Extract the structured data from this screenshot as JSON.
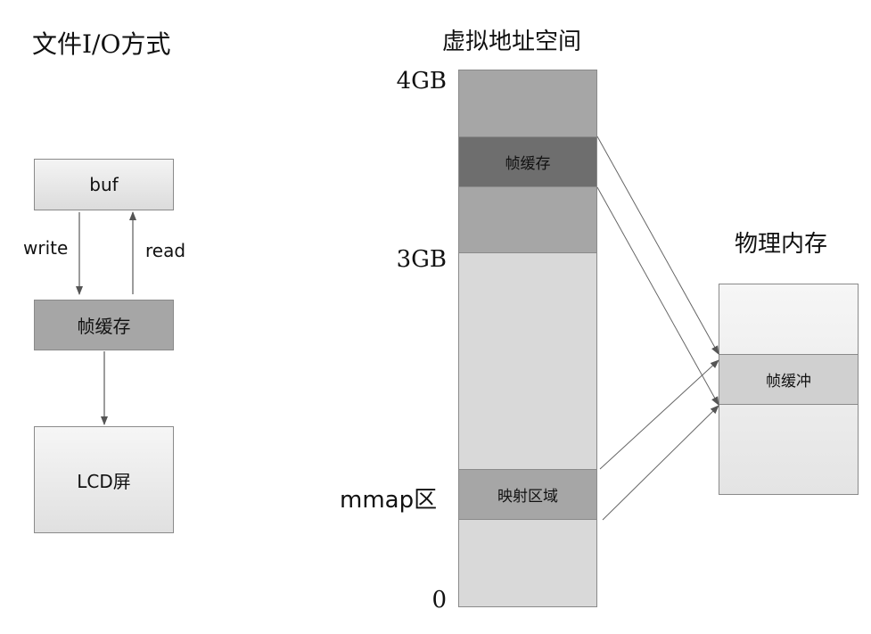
{
  "left_panel": {
    "title": "文件I/O方式",
    "buf_label": "buf",
    "write_label": "write",
    "read_label": "read",
    "framebuffer_label": "帧缓存",
    "lcd_label": "LCD屏"
  },
  "virtual_space": {
    "title": "虚拟地址空间",
    "label_4gb": "4GB",
    "label_3gb": "3GB",
    "label_mmap": "mmap区",
    "label_0": "0",
    "framebuffer_label": "帧缓存",
    "mapped_region_label": "映射区域"
  },
  "physical_memory": {
    "title": "物理内存",
    "framebuffer_label": "帧缓冲"
  },
  "colors": {
    "light_gray": "#d9d9d9",
    "mid_gray": "#a6a6a6",
    "dark_gray": "#6e6e6e",
    "gradient_top": "#f6f6f6",
    "gradient_bottom": "#e4e4e4"
  }
}
